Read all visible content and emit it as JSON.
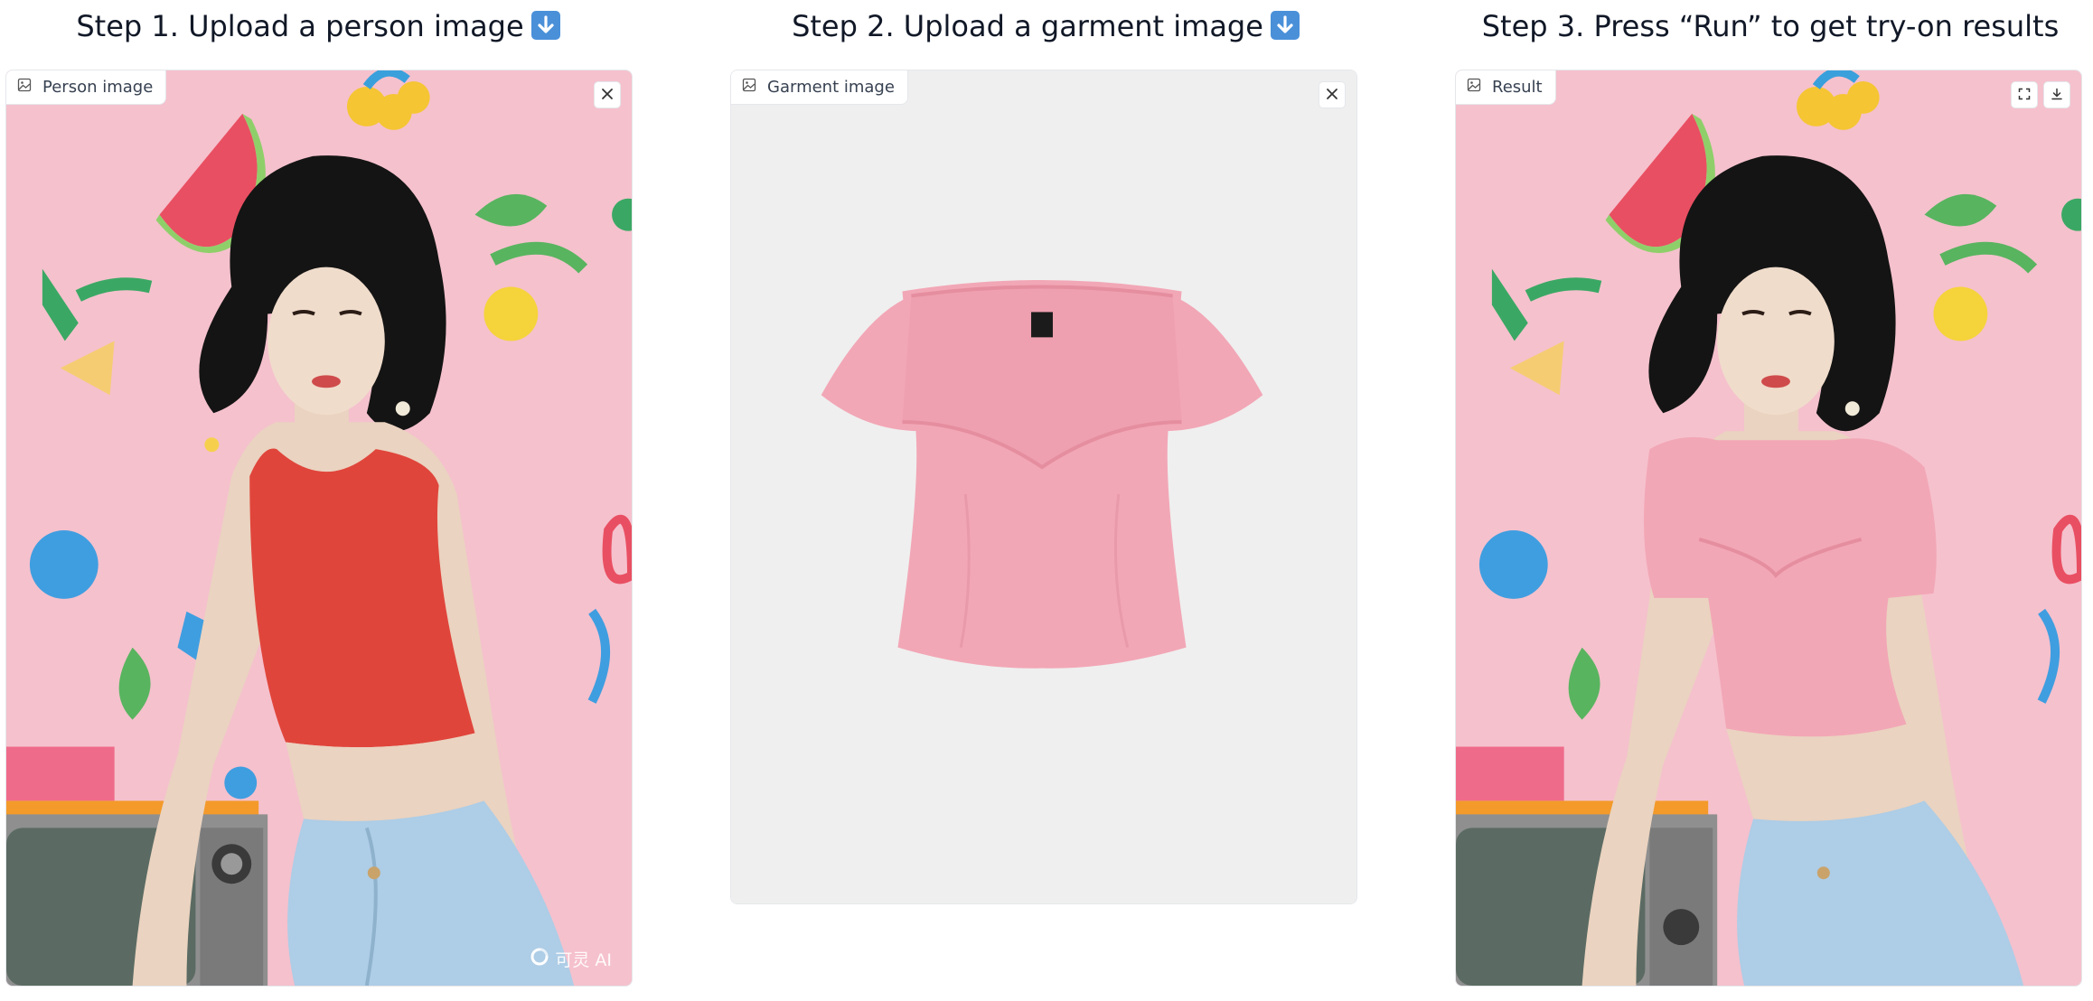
{
  "steps": {
    "step1_title": "Step 1. Upload a person image",
    "step2_title": "Step 2. Upload a garment image",
    "step3_title": "Step 3. Press “Run” to get try-on results"
  },
  "panels": {
    "person": {
      "label": "Person image",
      "icon": "image-icon",
      "action_icon": "close-icon"
    },
    "garment": {
      "label": "Garment image",
      "icon": "image-icon",
      "action_icon": "close-icon"
    },
    "result": {
      "label": "Result",
      "icon": "image-icon",
      "action_icons": [
        "fullscreen-icon",
        "download-icon"
      ]
    }
  },
  "watermark": {
    "text": "可灵 AI",
    "icon": "kling-logo-icon"
  },
  "colors": {
    "background": "#ffffff",
    "title_emoji": "#4a90d9",
    "wallpaper_pink": "#f3b9c6",
    "red_top": "#e0453b",
    "pink_top": "#f2a7b6",
    "jeans": "#aecde6",
    "garment_bg": "#efefef"
  }
}
